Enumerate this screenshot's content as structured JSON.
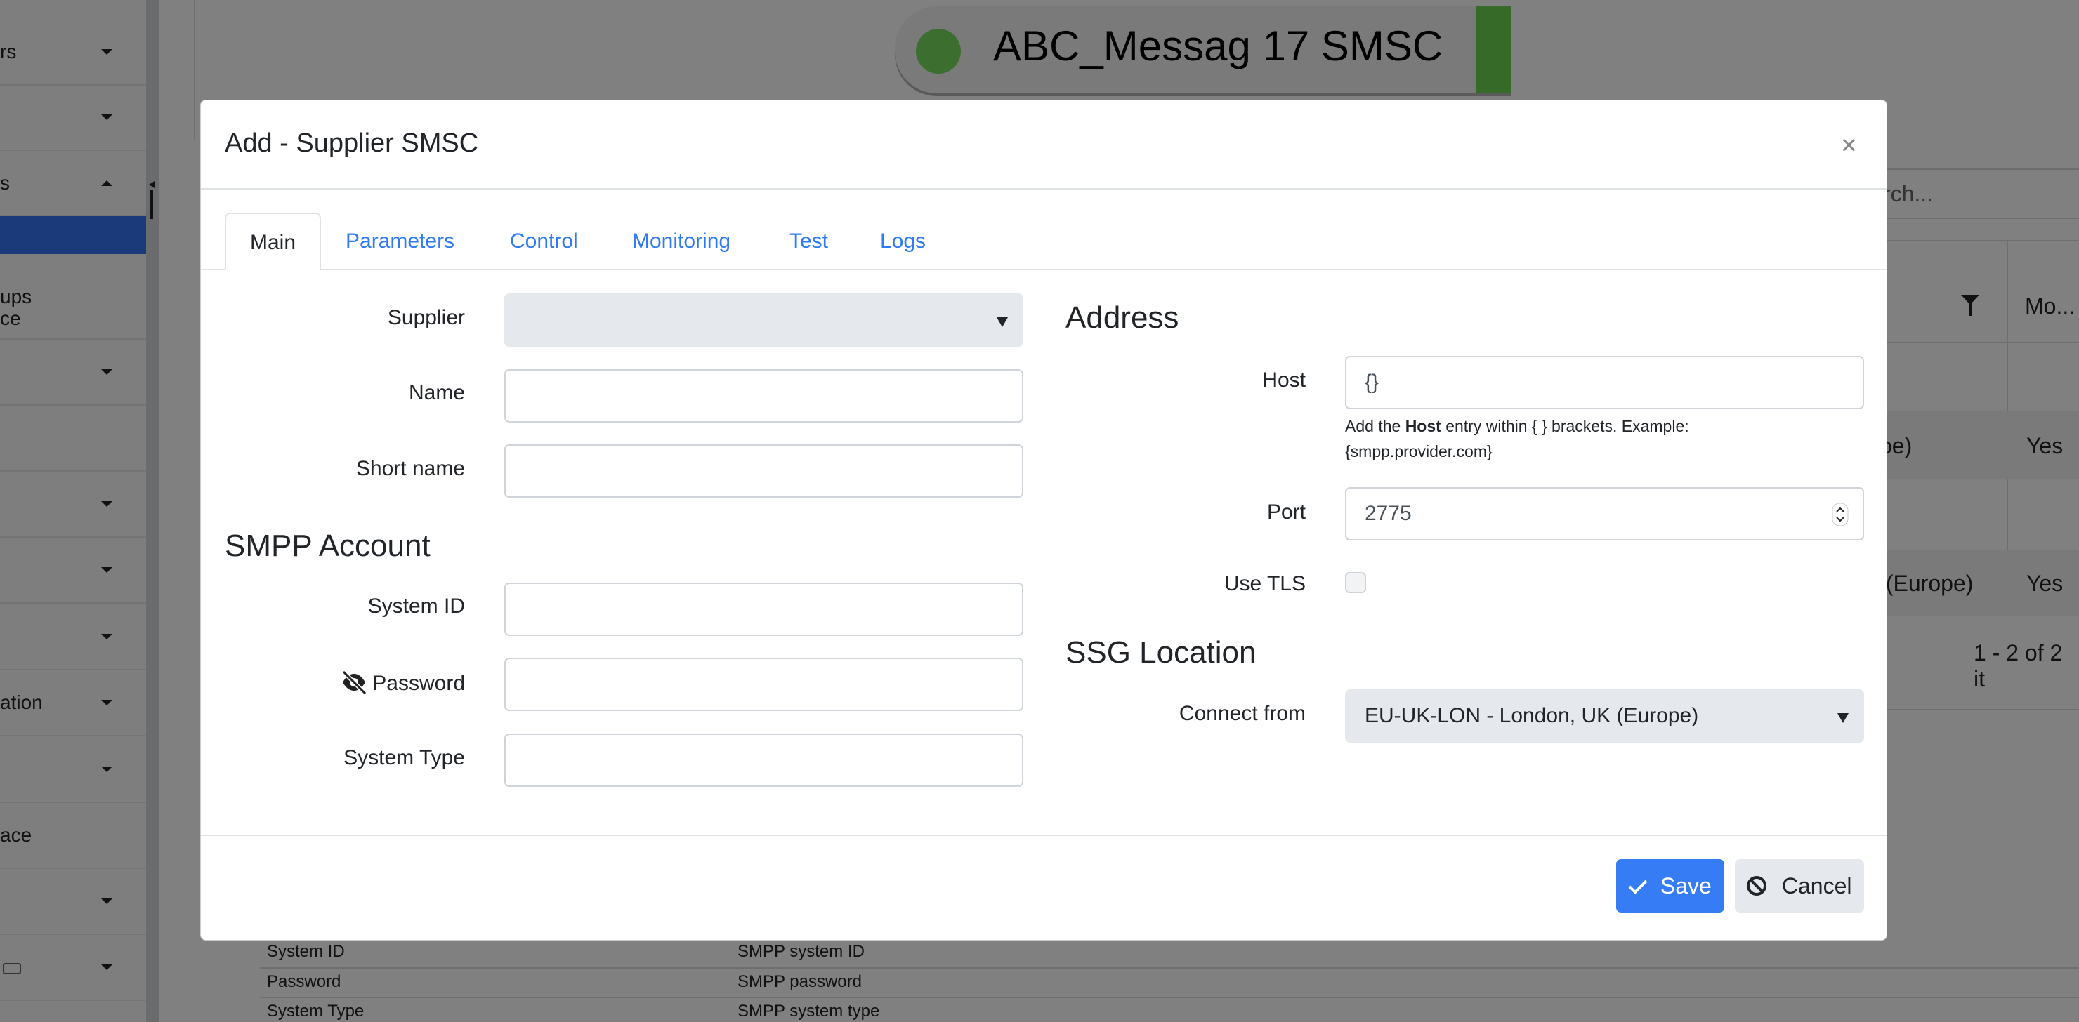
{
  "background": {
    "sidebar_items": [
      {
        "label": "rs",
        "arrow": "down"
      },
      {
        "label": "",
        "arrow": "down"
      },
      {
        "label": "s",
        "arrow": "up"
      },
      {
        "label": "ups",
        "arrow": ""
      },
      {
        "label": "ce",
        "arrow": ""
      },
      {
        "label": "",
        "arrow": "down"
      },
      {
        "label": "",
        "arrow": ""
      },
      {
        "label": "",
        "arrow": "down"
      },
      {
        "label": "",
        "arrow": "down"
      },
      {
        "label": "",
        "arrow": "down"
      },
      {
        "label": "ation",
        "arrow": "down"
      },
      {
        "label": "",
        "arrow": "down"
      },
      {
        "label": "ace",
        "arrow": ""
      },
      {
        "label": "",
        "arrow": "down"
      },
      {
        "label": "",
        "arrow": "down",
        "icon": "lock-icon"
      }
    ],
    "status_pill": {
      "name": "ABC_Messag 17 SMSC",
      "status_color": "#4caf3a"
    },
    "search_placeholder": "Search...",
    "table_header_partial": "Mo...",
    "table_rows": [
      {
        "col1": "pe)",
        "col2": "Yes"
      },
      {
        "col1": "y (Europe)",
        "col2": "Yes"
      }
    ],
    "pagination": "1 - 2 of 2 it",
    "param_rows": [
      {
        "name": "System ID",
        "desc": "SMPP system ID"
      },
      {
        "name": "Password",
        "desc": "SMPP password"
      },
      {
        "name": "System Type",
        "desc": "SMPP system type"
      }
    ]
  },
  "modal": {
    "title": "Add - Supplier SMSC",
    "tabs": [
      "Main",
      "Parameters",
      "Control",
      "Monitoring",
      "Test",
      "Logs"
    ],
    "active_tab": "Main",
    "left": {
      "supplier_label": "Supplier",
      "supplier_value": "",
      "name_label": "Name",
      "name_value": "",
      "short_name_label": "Short name",
      "short_name_value": "",
      "smpp_heading": "SMPP Account",
      "system_id_label": "System ID",
      "system_id_value": "",
      "password_label": "Password",
      "password_value": "",
      "system_type_label": "System Type",
      "system_type_value": ""
    },
    "right": {
      "address_heading": "Address",
      "host_label": "Host",
      "host_value": "{}",
      "host_help_pre": "Add the ",
      "host_help_bold": "Host",
      "host_help_post": " entry within { } brackets. Example:",
      "host_help_example": "{smpp.provider.com}",
      "port_label": "Port",
      "port_value": "2775",
      "tls_label": "Use TLS",
      "tls_checked": false,
      "ssg_heading": "SSG Location",
      "connect_label": "Connect from",
      "connect_value": "EU-UK-LON - London, UK (Europe)"
    },
    "footer": {
      "save": "Save",
      "cancel": "Cancel"
    }
  },
  "colors": {
    "accent": "#367cf5",
    "sidebar_selected": "#1a3a7a"
  }
}
